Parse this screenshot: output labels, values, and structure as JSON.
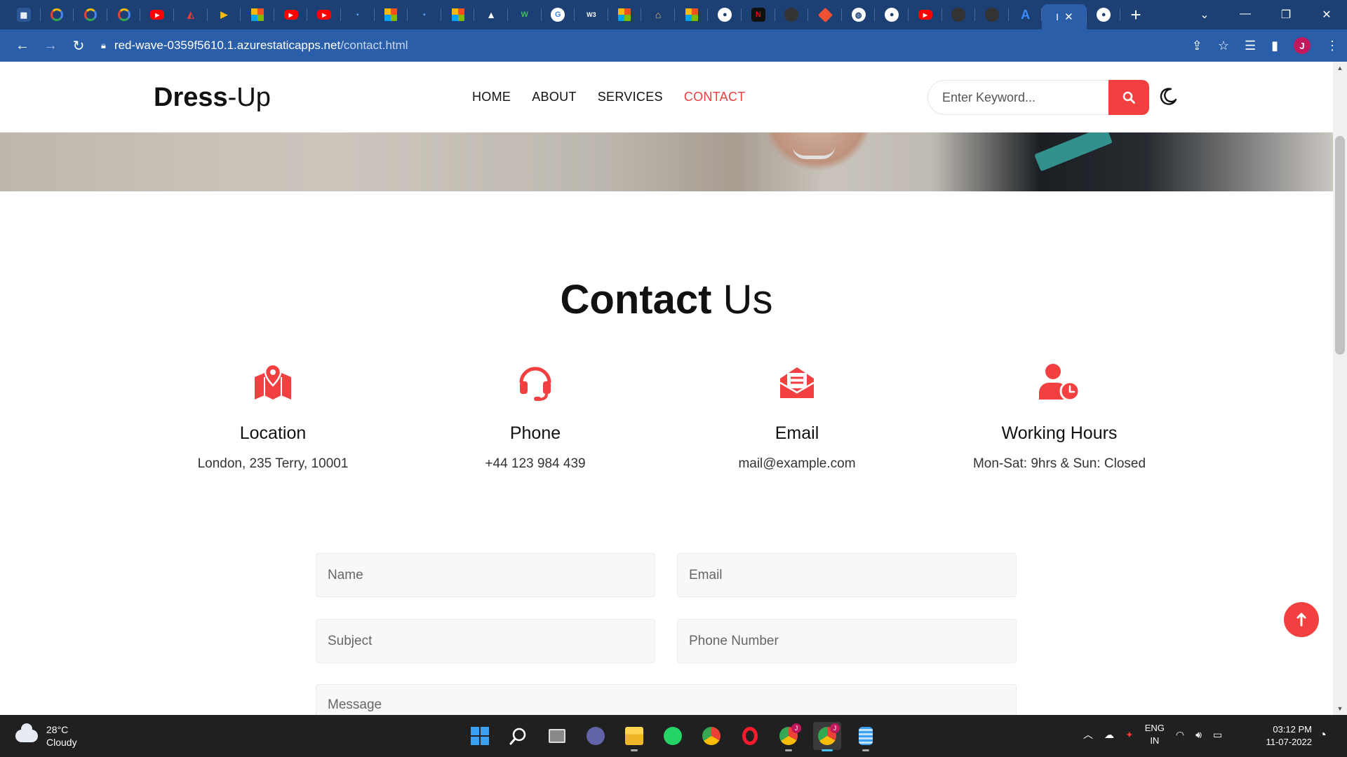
{
  "browser": {
    "tab_icons": [
      "window-icon",
      "google-cloud-icon",
      "google-cloud-icon",
      "google-cloud-icon",
      "youtube-icon",
      "adobe-icon",
      "play-icon",
      "microsoft-icon",
      "youtube-icon",
      "youtube-icon",
      "azure-icon",
      "microsoft-icon",
      "azure-icon",
      "microsoft-icon",
      "mountain-icon",
      "w-icon",
      "google-icon",
      "w3schools-icon",
      "microsoft-icon",
      "bridge-icon",
      "microsoft-icon",
      "github-icon",
      "netflix-icon",
      "github-icon",
      "git-icon",
      "globe-icon",
      "github-icon",
      "youtube-icon",
      "github-icon",
      "github-icon",
      "azure-a-icon"
    ],
    "tab_glyphs": {
      "w3": "W3",
      "n": "N",
      "w": "W",
      "g": "G",
      "a": "A"
    },
    "active_tab": {
      "label": "I",
      "close": "✕"
    },
    "new_tab": "+",
    "url_host": "red-wave-0359f5610.1.azurestaticapps.net",
    "url_path": "/contact.html",
    "profile_initial": "J"
  },
  "site": {
    "logo_bold": "Dress",
    "logo_light": "-Up",
    "nav": [
      {
        "label": "HOME",
        "active": false
      },
      {
        "label": "ABOUT",
        "active": false
      },
      {
        "label": "SERVICES",
        "active": false
      },
      {
        "label": "CONTACT",
        "active": true
      }
    ],
    "search_placeholder": "Enter Keyword...",
    "accent": "#f1403f"
  },
  "contact": {
    "title_bold": "Contact",
    "title_light": " Us",
    "cards": [
      {
        "icon": "map-pin-icon",
        "title": "Location",
        "value": "London, 235 Terry, 10001"
      },
      {
        "icon": "headset-icon",
        "title": "Phone",
        "value": "+44 123 984 439"
      },
      {
        "icon": "envelope-icon",
        "title": "Email",
        "value": "mail@example.com"
      },
      {
        "icon": "user-clock-icon",
        "title": "Working Hours",
        "value": "Mon-Sat: 9hrs & Sun: Closed"
      }
    ],
    "form": {
      "name_placeholder": "Name",
      "email_placeholder": "Email",
      "subject_placeholder": "Subject",
      "phone_placeholder": "Phone Number",
      "message_placeholder": "Message"
    }
  },
  "taskbar": {
    "temperature": "28°C",
    "condition": "Cloudy",
    "lang_top": "ENG",
    "lang_bottom": "IN",
    "time": "03:12 PM",
    "date": "11-07-2022",
    "chrome_badge": "J"
  }
}
